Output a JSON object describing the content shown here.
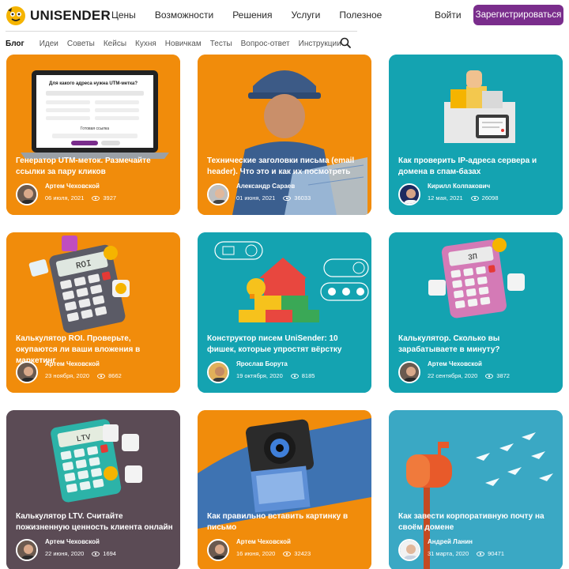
{
  "brand": {
    "name": "UNISENDER"
  },
  "topnav": {
    "items": [
      "Цены",
      "Возможности",
      "Решения",
      "Услуги",
      "Полезное"
    ]
  },
  "auth": {
    "login": "Войти",
    "register": "Зарегистрироваться"
  },
  "subnav": {
    "active": "Блог",
    "items": [
      "Идеи",
      "Советы",
      "Кейсы",
      "Кухня",
      "Новичкам",
      "Тесты",
      "Вопрос-ответ",
      "Инструкции"
    ]
  },
  "screen_texts": {
    "utm_heading": "Для какого адреса нужна UTM-метка?",
    "utm_result": "Готовая ссылка",
    "roi_display": "ROI",
    "calc_display": "3П",
    "ltv_display": "LTV"
  },
  "cards": [
    {
      "title": "Генератор UTM-меток. Размечайте ссылки за пару кликов",
      "author": "Артем Чеховской",
      "date": "06 июля, 2021",
      "views": "3927",
      "bg": "#f18c0b"
    },
    {
      "title": "Технические заголовки письма (email header). Что это и как их посмотреть",
      "author": "Александр Сараев",
      "date": "01 июня, 2021",
      "views": "36033",
      "bg": "#f18c0b"
    },
    {
      "title": "Как проверить IP-адреса сервера и домена в спам-базах",
      "author": "Кирилл Колпакович",
      "date": "12 мая, 2021",
      "views": "26098",
      "bg": "#14a3b1"
    },
    {
      "title": "Калькулятор ROI. Проверьте, окупаются ли ваши вложения в маркетинг",
      "author": "Артем Чеховской",
      "date": "23 ноября, 2020",
      "views": "8662",
      "bg": "#f18c0b"
    },
    {
      "title": "Конструктор писем UniSender: 10 фишек, которые упростят вёрстку",
      "author": "Ярослав Борута",
      "date": "19 октября, 2020",
      "views": "8185",
      "bg": "#14a3b1"
    },
    {
      "title": "Калькулятор. Сколько вы зарабатываете в минуту?",
      "author": "Артем Чеховской",
      "date": "22 сентября, 2020",
      "views": "3872",
      "bg": "#14a3b1"
    },
    {
      "title": "Калькулятор LTV. Считайте пожизненную ценность клиента онлайн",
      "author": "Артем Чеховской",
      "date": "22 июня, 2020",
      "views": "1694",
      "bg": "#5b4b55"
    },
    {
      "title": "Как правильно вставить картинку в письмо",
      "author": "Артем Чеховской",
      "date": "16 июня, 2020",
      "views": "32423",
      "bg": "#f18c0b"
    },
    {
      "title": "Как завести корпоративную почту на своём домене",
      "author": "Андрей Ланин",
      "date": "31 марта, 2020",
      "views": "90471",
      "bg": "#14a3b1"
    }
  ]
}
